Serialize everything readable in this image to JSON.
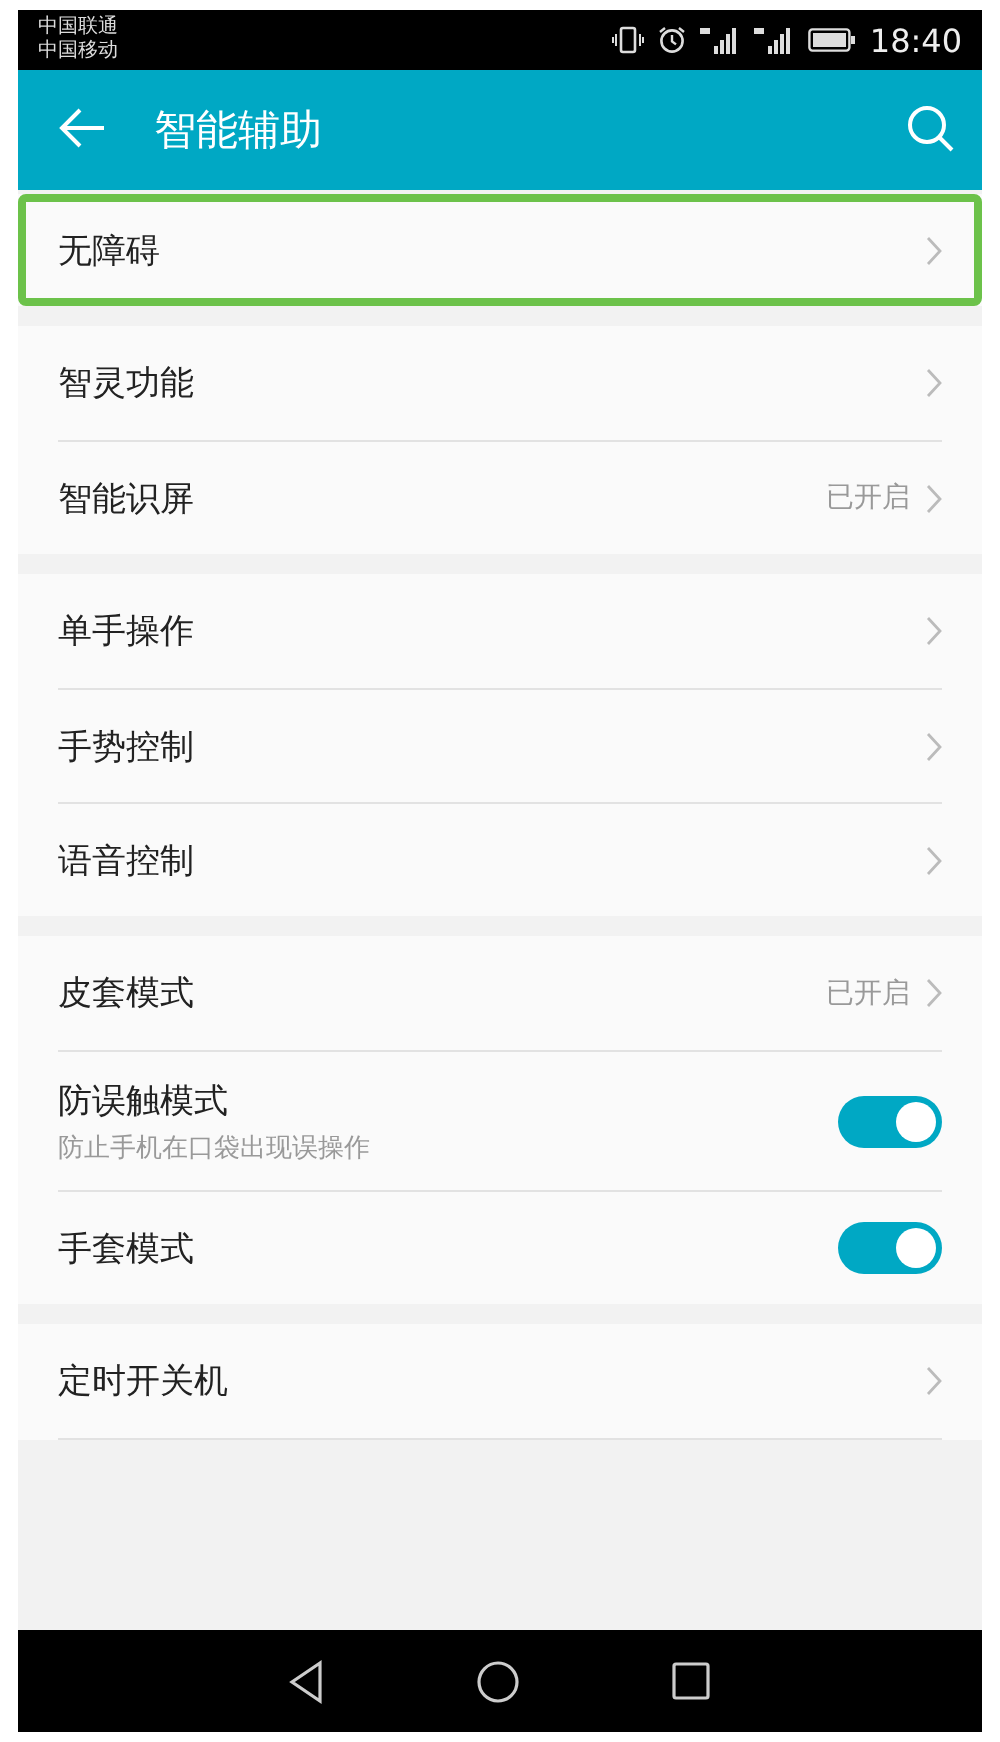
{
  "status_bar": {
    "carriers": [
      "中国联通",
      "中国移动"
    ],
    "time": "18:40"
  },
  "app_bar": {
    "title": "智能辅助"
  },
  "groups": [
    {
      "items": [
        {
          "kind": "link",
          "label": "无障碍",
          "highlighted": true
        }
      ]
    },
    {
      "items": [
        {
          "kind": "link",
          "label": "智灵功能",
          "highlighted": false
        },
        {
          "kind": "link",
          "label": "智能识屏",
          "value": "已开启",
          "highlighted": false
        }
      ]
    },
    {
      "items": [
        {
          "kind": "link",
          "label": "单手操作",
          "highlighted": false
        },
        {
          "kind": "link",
          "label": "手势控制",
          "highlighted": false
        },
        {
          "kind": "link",
          "label": "语音控制",
          "highlighted": false
        }
      ]
    },
    {
      "items": [
        {
          "kind": "link",
          "label": "皮套模式",
          "value": "已开启",
          "highlighted": false
        },
        {
          "kind": "toggle",
          "label": "防误触模式",
          "subtitle": "防止手机在口袋出现误操作",
          "on": true,
          "highlighted": false
        },
        {
          "kind": "toggle",
          "label": "手套模式",
          "on": true,
          "highlighted": false
        }
      ]
    },
    {
      "items": [
        {
          "kind": "link",
          "label": "定时开关机",
          "highlighted": false
        }
      ]
    }
  ]
}
